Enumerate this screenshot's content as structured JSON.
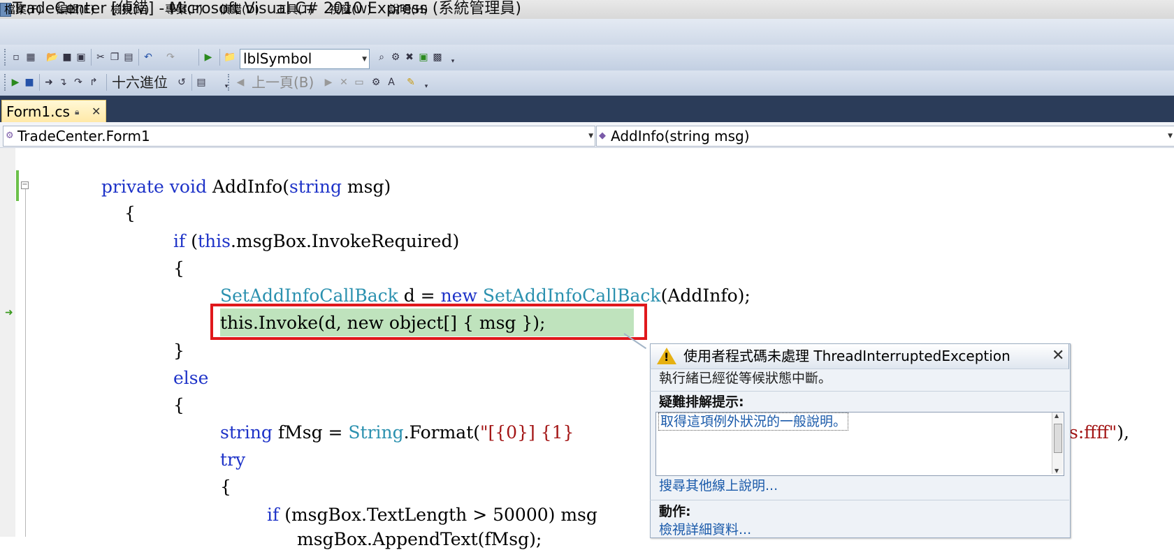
{
  "window": {
    "title": "TradeCenter [偵錯] - Microsoft Visual C# 2010 Express (系統管理員)"
  },
  "menu": {
    "items": [
      "檔案(F)",
      "編輯(E)",
      "檢視(V)",
      "專案(P)",
      "偵錯(D)",
      "工具(T)",
      "視窗(W)",
      "說明(H)"
    ]
  },
  "toolbar1": {
    "find_combo_value": "lblSymbol"
  },
  "toolbar2": {
    "hex_label": "十六進位",
    "prev_label": "上一頁(B)"
  },
  "tabs": {
    "active": "Form1.cs"
  },
  "nav": {
    "class_combo": "TradeCenter.Form1",
    "member_combo": "AddInfo(string msg)"
  },
  "code": {
    "l1": {
      "kw1": "private",
      "kw2": "void",
      "name": "AddInfo(",
      "kw3": "string",
      "rest": " msg)"
    },
    "l2": "{",
    "l3": {
      "kw1": "if",
      "open": " (",
      "kw2": "this",
      "rest": ".msgBox.InvokeRequired)"
    },
    "l4": "{",
    "l5": {
      "t1": "SetAddInfoCallBack",
      "mid": " d = ",
      "kw": "new",
      "sp": " ",
      "t2": "SetAddInfoCallBack",
      "rest": "(AddInfo);"
    },
    "l6": "this.Invoke(d, new object[] { msg });",
    "l7": "}",
    "l8": "else",
    "l9": "{",
    "l10": {
      "kw": "string",
      "mid": " fMsg = ",
      "ty": "String",
      "fmt": ".Format(",
      "s1": "\"[{0}] {1}",
      "tail_s": "s:ffff\"",
      "tail": "),"
    },
    "l11": "try",
    "l12": "{",
    "l13": {
      "kw": "if",
      "rest": " (msgBox.TextLength > 50000) msg"
    },
    "l14": "msgBox.AppendText(fMsg);"
  },
  "exception_assistant": {
    "title": "使用者程式碼未處理 ThreadInterruptedException",
    "message": "執行緒已經從等候狀態中斷。",
    "tips_header": "疑難排解提示:",
    "tip_link": "取得這項例外狀況的一般說明。",
    "search_link": "搜尋其他線上說明...",
    "actions_header": "動作:",
    "detail_link": "檢視詳細資料..."
  },
  "colors": {
    "keyword": "#1e33c8",
    "type": "#2b91af",
    "string": "#a31515",
    "highlight": "#bfe3bd",
    "annotation_box": "#e0181c"
  }
}
